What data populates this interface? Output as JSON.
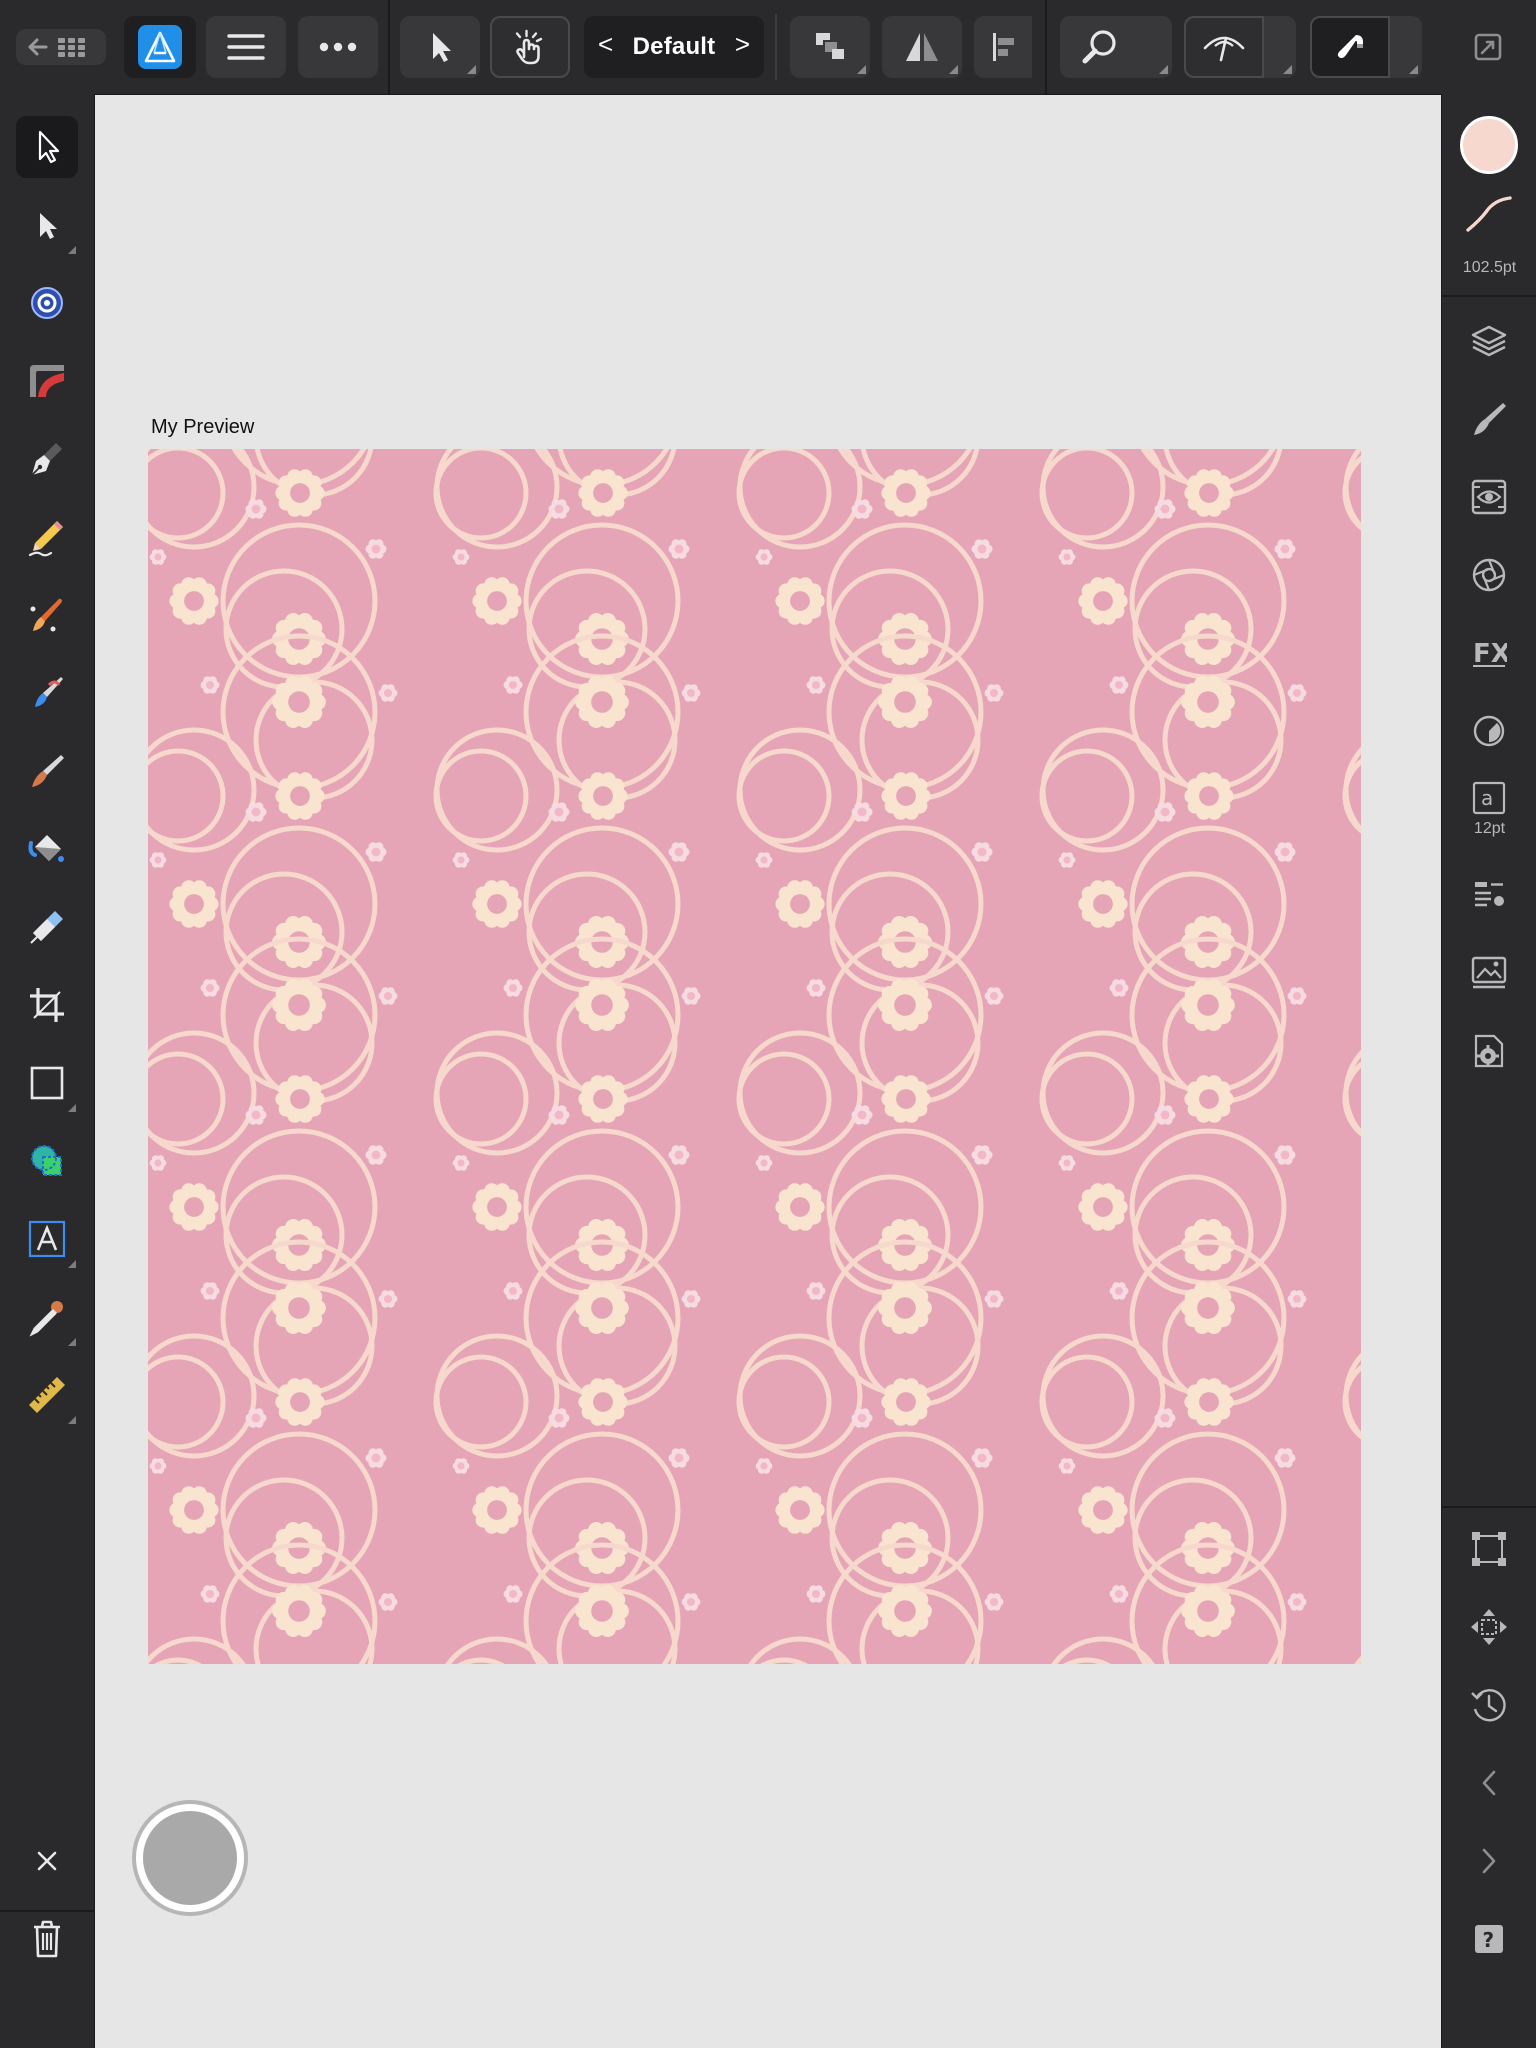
{
  "toolbar": {
    "assistant": {
      "label": "Default",
      "prev_glyph": "<",
      "next_glyph": ">"
    },
    "icons": [
      "back-grid-icon",
      "designer-persona-icon",
      "menu-icon",
      "more-icon",
      "move-icon",
      "touch-gesture-icon",
      "arrange-icon",
      "flip-icon",
      "align-icon",
      "zoom-icon",
      "view-quality-icon",
      "snapping-icon",
      "fullscreen-icon"
    ]
  },
  "tools": [
    {
      "name": "move-tool",
      "icon": "pointer-icon",
      "active": true
    },
    {
      "name": "node-tool",
      "icon": "node-pointer-icon"
    },
    {
      "name": "point-transform-tool",
      "icon": "target-icon"
    },
    {
      "name": "corner-tool",
      "icon": "corner-icon"
    },
    {
      "name": "pen-tool",
      "icon": "pen-nib-icon"
    },
    {
      "name": "pencil-tool",
      "icon": "pencil-icon"
    },
    {
      "name": "vector-brush-tool",
      "icon": "vector-brush-icon"
    },
    {
      "name": "paint-brush-tool",
      "icon": "paint-brush-icon"
    },
    {
      "name": "pixel-brush-tool",
      "icon": "pixel-brush-icon"
    },
    {
      "name": "fill-tool",
      "icon": "fill-bucket-icon"
    },
    {
      "name": "transparency-tool",
      "icon": "transparency-icon"
    },
    {
      "name": "crop-tool",
      "icon": "crop-icon"
    },
    {
      "name": "rectangle-tool",
      "icon": "rectangle-icon"
    },
    {
      "name": "shape-builder-tool",
      "icon": "shape-builder-icon"
    },
    {
      "name": "artistic-text-tool",
      "icon": "text-a-icon"
    },
    {
      "name": "color-picker-tool",
      "icon": "eyedropper-icon"
    },
    {
      "name": "measure-tool",
      "icon": "ruler-icon"
    }
  ],
  "bottom_tools": [
    "close-icon",
    "trash-icon"
  ],
  "studio": {
    "stroke_width": "102.5pt",
    "text_size": "12pt",
    "fill_color": "#f7d8cf",
    "panels": [
      "layers-icon",
      "brushes-icon",
      "appearance-icon",
      "adjustments-icon",
      "fx-icon",
      "color-icon",
      "text-styles-icon",
      "paragraph-icon",
      "assets-icon",
      "settings-icon"
    ],
    "bottom_panels": [
      "transform-icon",
      "navigator-icon",
      "history-icon",
      "undo-icon",
      "redo-icon",
      "help-icon"
    ]
  },
  "document": {
    "title": "My Preview",
    "pattern": {
      "background": "#e5a5b6",
      "motif": "#f9e4cf",
      "flower_center": "#f3b8c7"
    }
  }
}
